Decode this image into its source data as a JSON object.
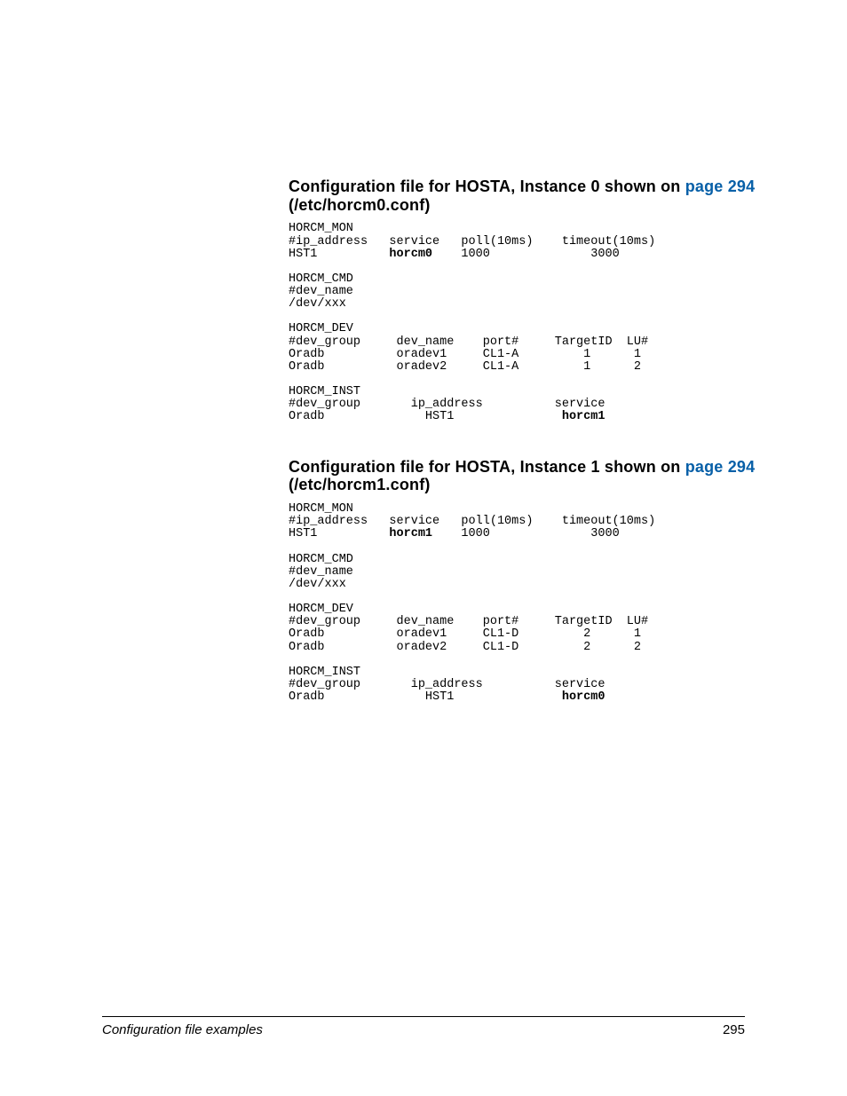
{
  "sections": [
    {
      "heading_before": "Configuration file for HOSTA, Instance 0 shown on ",
      "heading_link": "page 294",
      "heading_after": " (/etc/horcm0.conf)",
      "mon": {
        "title": "HORCM_MON",
        "header": "#ip_address   service   poll(10ms)    timeout(10ms)",
        "row": "HST1          ",
        "row_b": "horcm0",
        "row2": "    1000              3000"
      },
      "cmd": {
        "title": "HORCM_CMD",
        "header": "#dev_name",
        "row": "/dev/xxx"
      },
      "dev": {
        "title": "HORCM_DEV",
        "header": "#dev_group     dev_name    port#     TargetID  LU#",
        "r1": "Oradb          oradev1     CL1-A         1      1",
        "r2": "Oradb          oradev2     CL1-A         1      2"
      },
      "inst": {
        "title": "HORCM_INST",
        "header": "#dev_group       ip_address          service",
        "row": "Oradb              HST1               ",
        "row_b": "horcm1"
      }
    },
    {
      "heading_before": "Configuration file for HOSTA, Instance 1 shown on ",
      "heading_link": "page 294",
      "heading_after": " (/etc/horcm1.conf)",
      "mon": {
        "title": "HORCM_MON",
        "header": "#ip_address   service   poll(10ms)    timeout(10ms)",
        "row": "HST1          ",
        "row_b": "horcm1",
        "row2": "    1000              3000"
      },
      "cmd": {
        "title": "HORCM_CMD",
        "header": "#dev_name",
        "row": "/dev/xxx"
      },
      "dev": {
        "title": "HORCM_DEV",
        "header": "#dev_group     dev_name    port#     TargetID  LU#",
        "r1": "Oradb          oradev1     CL1-D         2      1",
        "r2": "Oradb          oradev2     CL1-D         2      2"
      },
      "inst": {
        "title": "HORCM_INST",
        "header": "#dev_group       ip_address          service",
        "row": "Oradb              HST1               ",
        "row_b": "horcm0"
      }
    }
  ],
  "footer": {
    "left": "Configuration file examples",
    "right": "295"
  }
}
